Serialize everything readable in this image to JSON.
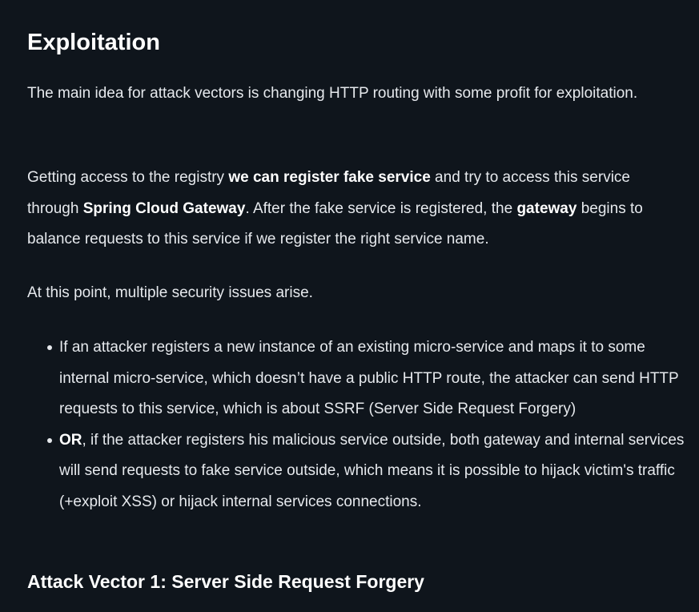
{
  "heading": "Exploitation",
  "paragraph1": "The main idea for attack vectors is changing HTTP routing with some profit for exploitation.",
  "paragraph2": {
    "t1": "Getting access to the registry ",
    "b1": "we can register fake service",
    "t2": " and try to access this service through ",
    "b2": "Spring Cloud Gateway",
    "t3": ". After the fake service is registered, the ",
    "b3": "gateway",
    "t4": " begins to balance requests to this service if we register the right service name."
  },
  "paragraph3": "At this point, multiple security issues arise.",
  "list": {
    "item1": "If an attacker registers a new instance of an existing micro-service and maps it to some internal micro-service, which doesn’t have a public HTTP route, the attacker can send HTTP requests to this service, which is about SSRF (Server Side Request Forgery)",
    "item2_bold": "OR",
    "item2_rest": ", if the attacker registers his malicious service outside, both gateway and internal services will send requests to fake service outside, which means it is possible to hijack victim's traffic (+exploit XSS) or hijack internal services connections."
  },
  "subheading": "Attack Vector 1: Server Side Request Forgery"
}
